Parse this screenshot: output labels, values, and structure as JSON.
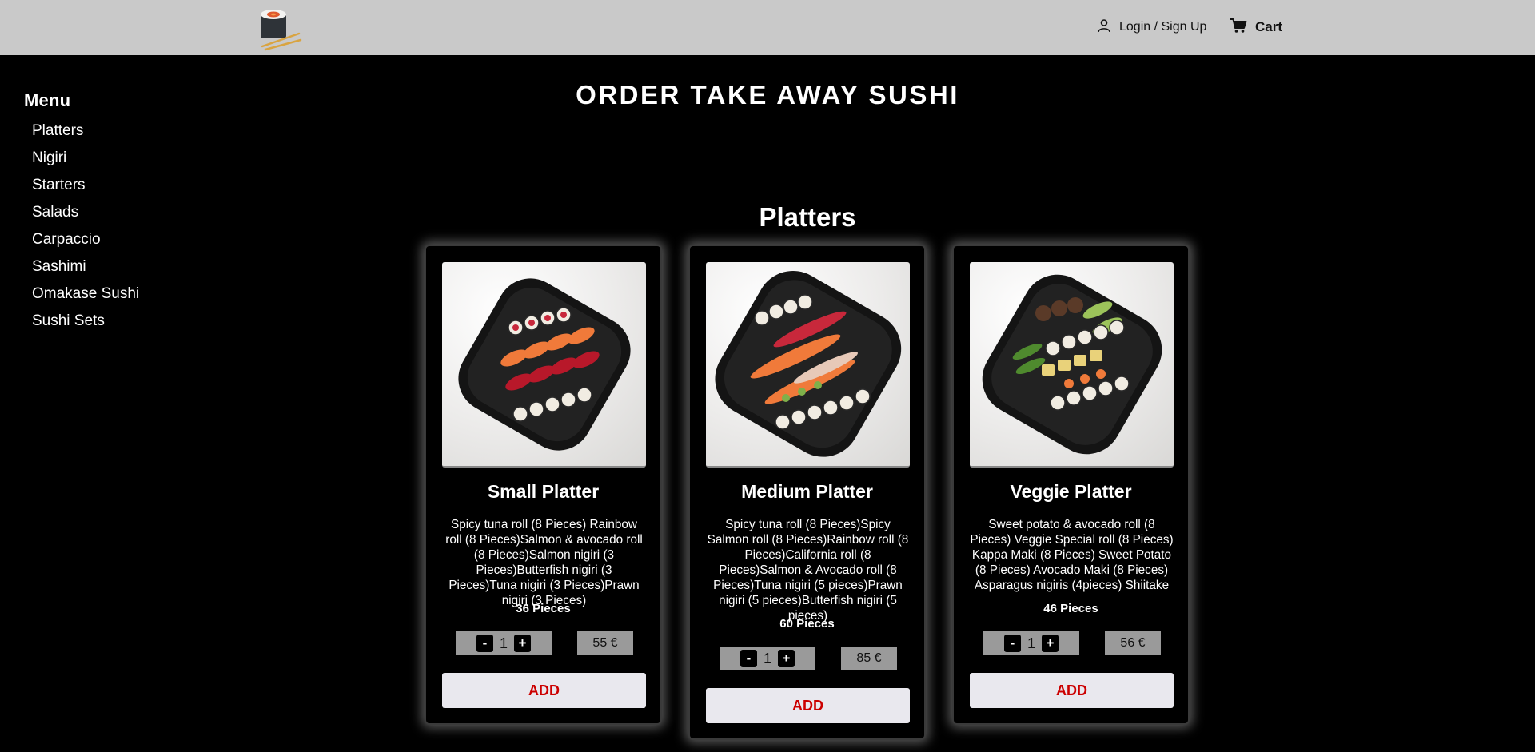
{
  "header": {
    "logo_icon": "sushi-roll-logo",
    "login_label": "Login / Sign Up",
    "login_icon": "user-icon",
    "cart_label": "Cart",
    "cart_icon": "cart-icon"
  },
  "sidebar": {
    "title": "Menu",
    "items": [
      "Platters",
      "Nigiri",
      "Starters",
      "Salads",
      "Carpaccio",
      "Sashimi",
      "Omakase Sushi",
      "Sushi Sets"
    ]
  },
  "page_title": "ORDER TAKE AWAY SUSHI",
  "section_title": "Platters",
  "colors": {
    "add_text": "#cc0000",
    "header_bg": "#c9c9c9",
    "page_bg": "#000000"
  },
  "products": [
    {
      "name": "Small Platter",
      "description": "Spicy tuna roll (8 Pieces) Rainbow roll (8 Pieces)Salmon & avocado roll (8 Pieces)Salmon nigiri (3 Pieces)Butterfish nigiri (3 Pieces)Tuna nigiri (3 Pieces)Prawn nigiri (3 Pieces)",
      "pieces": "36 Pieces",
      "quantity": "1",
      "minus": "-",
      "plus": "+",
      "price": "55 €",
      "add_label": "ADD"
    },
    {
      "name": "Medium Platter",
      "description": "Spicy tuna roll (8 Pieces)Spicy Salmon roll (8 Pieces)Rainbow roll (8 Pieces)California roll (8 Pieces)Salmon & Avocado roll (8 Pieces)Tuna nigiri (5 pieces)Prawn nigiri (5 pieces)Butterfish nigiri (5 pieces)",
      "pieces": "60 Pieces",
      "quantity": "1",
      "minus": "-",
      "plus": "+",
      "price": "85 €",
      "add_label": "ADD"
    },
    {
      "name": "Veggie Platter",
      "description": "Sweet potato & avocado roll (8 Pieces) Veggie Special roll (8 Pieces) Kappa Maki (8 Pieces) Sweet Potato (8 Pieces) Avocado Maki (8 Pieces) Asparagus nigiris (4pieces) Shiitake",
      "pieces": "46 Pieces",
      "quantity": "1",
      "minus": "-",
      "plus": "+",
      "price": "56 €",
      "add_label": "ADD"
    }
  ]
}
